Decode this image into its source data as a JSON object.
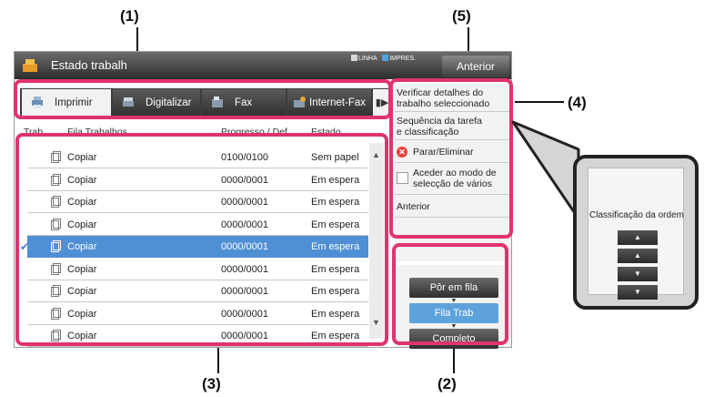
{
  "callouts": [
    "(1)",
    "(2)",
    "(3)",
    "(4)",
    "(5)"
  ],
  "window": {
    "title": "Estado trabalh",
    "legend_line": "LINHA",
    "legend_print": "IMPRES.",
    "back_button": "Anterior"
  },
  "tabs": [
    {
      "label": "Imprimir",
      "icon": "printer-icon",
      "active": true
    },
    {
      "label": "Digitalizar",
      "icon": "scanner-icon",
      "active": false
    },
    {
      "label": "Fax",
      "icon": "fax-icon",
      "active": false
    },
    {
      "label": "Internet-Fax",
      "icon": "internet-fax-icon",
      "active": false
    }
  ],
  "table": {
    "headers": {
      "trab": "Trab.",
      "fila": "Fila Trabalhos",
      "progresso": "Progresso / Def.",
      "estado": "Estado"
    },
    "rows": [
      {
        "name": "Copiar",
        "progress": "0100/0100",
        "status": "Sem papel",
        "selected": false
      },
      {
        "name": "Copiar",
        "progress": "0000/0001",
        "status": "Em espera",
        "selected": false
      },
      {
        "name": "Copiar",
        "progress": "0000/0001",
        "status": "Em espera",
        "selected": false
      },
      {
        "name": "Copiar",
        "progress": "0000/0001",
        "status": "Em espera",
        "selected": false
      },
      {
        "name": "Copiar",
        "progress": "0000/0001",
        "status": "Em espera",
        "selected": true
      },
      {
        "name": "Copiar",
        "progress": "0000/0001",
        "status": "Em espera",
        "selected": false
      },
      {
        "name": "Copiar",
        "progress": "0000/0001",
        "status": "Em espera",
        "selected": false
      },
      {
        "name": "Copiar",
        "progress": "0000/0001",
        "status": "Em espera",
        "selected": false
      },
      {
        "name": "Copiar",
        "progress": "0000/0001",
        "status": "Em espera",
        "selected": false
      }
    ]
  },
  "action_menu": {
    "check_details_1": "Verificar detalhes do",
    "check_details_2": "trabalho seleccionado",
    "sequence_1": "Sequência da tarefa",
    "sequence_2": "e classificação",
    "stop_delete": "Parar/Eliminar",
    "multi_select_1": "Aceder ao modo de",
    "multi_select_2": "selecção de vários",
    "back": "Anterior"
  },
  "queue_buttons": {
    "spool": "Pôr em fila",
    "job_queue": "Fila Trab",
    "complete": "Completo"
  },
  "popup": {
    "title": "Classificação da ordem",
    "buttons": [
      "move-to-top",
      "move-up",
      "move-down",
      "move-to-bottom"
    ]
  },
  "colors": {
    "highlight": "#e0336e",
    "selected_row": "#4f8fd4",
    "active_queue": "#5ea2dc"
  }
}
